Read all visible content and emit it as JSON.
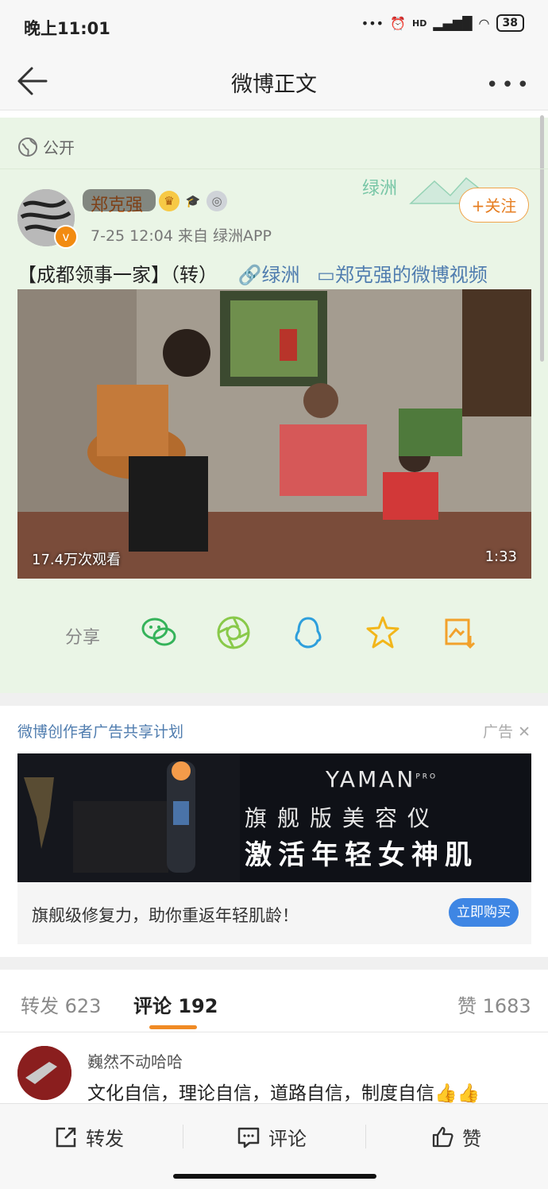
{
  "status_bar": {
    "time": "晚上11:01",
    "network": "HD",
    "battery": "38"
  },
  "nav": {
    "title": "微博正文"
  },
  "post": {
    "visibility": "公开",
    "username": "郑克强",
    "time_source": "7-25 12:04  来自 绿洲APP",
    "follow_label": "+关注",
    "oasis_logo_text": "绿洲",
    "content_text": "【成都领事一家】（转）",
    "link_oasis": "绿洲",
    "link_video": "郑克强的微博视频",
    "video": {
      "views": "17.4万次观看",
      "duration": "1:33"
    },
    "share_label": "分享",
    "share_icons": [
      "wechat-icon",
      "moments-icon",
      "qq-icon",
      "qzone-star-icon",
      "save-image-icon"
    ]
  },
  "ad": {
    "title": "微博创作者广告共享计划",
    "tag": "广告",
    "brand": "YAMAN",
    "brand_sup": "PRO",
    "line1": "旗舰版美容仪",
    "line2": "激活年轻女神肌",
    "description": "旗舰级修复力，助你重返年轻肌龄！",
    "buy_label": "立即购买"
  },
  "tabs": {
    "repost": "转发 623",
    "comment": "评论 192",
    "like": "赞 1683"
  },
  "comment": {
    "name": "巍然不动哈哈",
    "text": "文化自信，理论自信，道路自信，制度自信👍👍"
  },
  "bottom_bar": {
    "repost": "转发",
    "comment": "评论",
    "like": "赞"
  },
  "colors": {
    "post_bg": "#eaf5e6",
    "accent_orange": "#f08a24",
    "link_blue": "#507daf",
    "buy_blue": "#3e86e4"
  }
}
